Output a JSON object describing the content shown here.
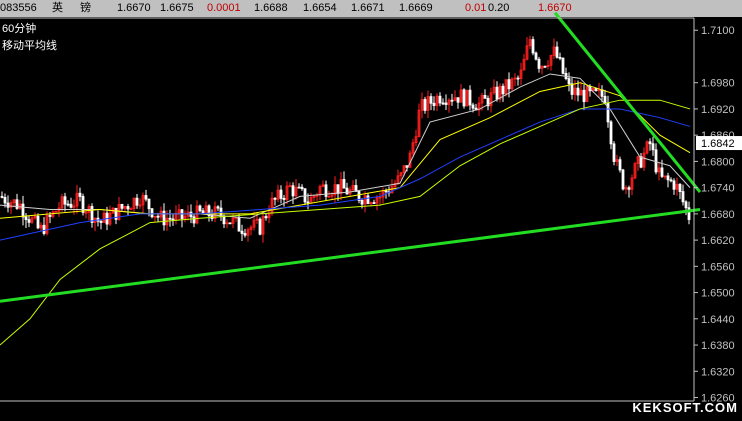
{
  "quote_bar": {
    "code": "083556",
    "name_part1": "英",
    "name_part2": "镑",
    "v1": "1.6670",
    "v2": "1.6675",
    "change": "0.0001",
    "v3": "1.6688",
    "v4": "1.6654",
    "v5": "1.6671",
    "v6": "1.6669",
    "v7": "0.01",
    "v8": "0.20",
    "last": "1.6670"
  },
  "labels": {
    "period": "60分钟",
    "indicator": "移动平均线"
  },
  "current_price": "1.6842",
  "watermark": "KEKSOFT.COM",
  "colors": {
    "up": "#ff2020",
    "down": "#ffffff",
    "ma_short": "#d0d0d0",
    "ma_mid": "#ffff00",
    "ma_long": "#2040ff",
    "ma_longer": "#c8ff00",
    "trend": "#22dd22",
    "axis": "#c0c0c0",
    "price_box": "#ffffff"
  },
  "chart_data": {
    "type": "line",
    "title": "",
    "xlabel": "",
    "ylabel": "",
    "ylim": [
      1.6252,
      1.7128
    ],
    "yticks": [
      1.71,
      1.698,
      1.692,
      1.686,
      1.68,
      1.674,
      1.668,
      1.662,
      1.656,
      1.65,
      1.644,
      1.638,
      1.632,
      1.626
    ],
    "price_series": [
      [
        0,
        1.672
      ],
      [
        20,
        1.67
      ],
      [
        40,
        1.664
      ],
      [
        60,
        1.67
      ],
      [
        80,
        1.671
      ],
      [
        100,
        1.666
      ],
      [
        120,
        1.669
      ],
      [
        140,
        1.672
      ],
      [
        160,
        1.667
      ],
      [
        180,
        1.667
      ],
      [
        200,
        1.668
      ],
      [
        220,
        1.668
      ],
      [
        240,
        1.665
      ],
      [
        260,
        1.665
      ],
      [
        270,
        1.67
      ],
      [
        290,
        1.674
      ],
      [
        310,
        1.671
      ],
      [
        320,
        1.674
      ],
      [
        340,
        1.674
      ],
      [
        360,
        1.672
      ],
      [
        380,
        1.672
      ],
      [
        400,
        1.676
      ],
      [
        410,
        1.681
      ],
      [
        420,
        1.692
      ],
      [
        440,
        1.695
      ],
      [
        460,
        1.695
      ],
      [
        480,
        1.693
      ],
      [
        500,
        1.696
      ],
      [
        520,
        1.699
      ],
      [
        530,
        1.708
      ],
      [
        540,
        1.702
      ],
      [
        555,
        1.705
      ],
      [
        570,
        1.696
      ],
      [
        590,
        1.695
      ],
      [
        605,
        1.695
      ],
      [
        615,
        1.68
      ],
      [
        625,
        1.674
      ],
      [
        640,
        1.68
      ],
      [
        650,
        1.684
      ],
      [
        660,
        1.676
      ],
      [
        675,
        1.675
      ],
      [
        690,
        1.667
      ]
    ],
    "moving_averages": [
      {
        "type": "short",
        "points": [
          [
            0,
            1.67
          ],
          [
            50,
            1.669
          ],
          [
            100,
            1.669
          ],
          [
            150,
            1.668
          ],
          [
            200,
            1.668
          ],
          [
            250,
            1.667
          ],
          [
            300,
            1.672
          ],
          [
            350,
            1.673
          ],
          [
            400,
            1.675
          ],
          [
            430,
            1.689
          ],
          [
            480,
            1.692
          ],
          [
            520,
            1.697
          ],
          [
            550,
            1.7
          ],
          [
            580,
            1.699
          ],
          [
            610,
            1.692
          ],
          [
            640,
            1.681
          ],
          [
            670,
            1.679
          ],
          [
            690,
            1.674
          ]
        ]
      },
      {
        "type": "mid",
        "points": [
          [
            0,
            1.667
          ],
          [
            50,
            1.668
          ],
          [
            100,
            1.669
          ],
          [
            150,
            1.668
          ],
          [
            200,
            1.668
          ],
          [
            250,
            1.668
          ],
          [
            300,
            1.67
          ],
          [
            350,
            1.672
          ],
          [
            400,
            1.674
          ],
          [
            440,
            1.685
          ],
          [
            490,
            1.69
          ],
          [
            540,
            1.696
          ],
          [
            580,
            1.698
          ],
          [
            620,
            1.695
          ],
          [
            660,
            1.686
          ],
          [
            690,
            1.682
          ]
        ]
      },
      {
        "type": "long",
        "points": [
          [
            0,
            1.662
          ],
          [
            40,
            1.664
          ],
          [
            80,
            1.666
          ],
          [
            140,
            1.668
          ],
          [
            200,
            1.668
          ],
          [
            260,
            1.669
          ],
          [
            320,
            1.67
          ],
          [
            380,
            1.672
          ],
          [
            420,
            1.676
          ],
          [
            460,
            1.681
          ],
          [
            500,
            1.685
          ],
          [
            540,
            1.689
          ],
          [
            580,
            1.692
          ],
          [
            620,
            1.692
          ],
          [
            660,
            1.69
          ],
          [
            690,
            1.688
          ]
        ]
      },
      {
        "type": "longer",
        "points": [
          [
            0,
            1.638
          ],
          [
            30,
            1.644
          ],
          [
            60,
            1.653
          ],
          [
            100,
            1.66
          ],
          [
            150,
            1.666
          ],
          [
            200,
            1.667
          ],
          [
            260,
            1.668
          ],
          [
            320,
            1.669
          ],
          [
            380,
            1.67
          ],
          [
            420,
            1.672
          ],
          [
            460,
            1.679
          ],
          [
            500,
            1.684
          ],
          [
            540,
            1.688
          ],
          [
            580,
            1.692
          ],
          [
            620,
            1.694
          ],
          [
            660,
            1.694
          ],
          [
            690,
            1.692
          ]
        ]
      }
    ],
    "trend_lines": [
      {
        "name": "support",
        "from": [
          0,
          1.648
        ],
        "to": [
          700,
          1.669
        ]
      },
      {
        "name": "resistance",
        "from": [
          555,
          1.714
        ],
        "to": [
          700,
          1.673
        ]
      }
    ],
    "grid": false,
    "legend": "none"
  }
}
